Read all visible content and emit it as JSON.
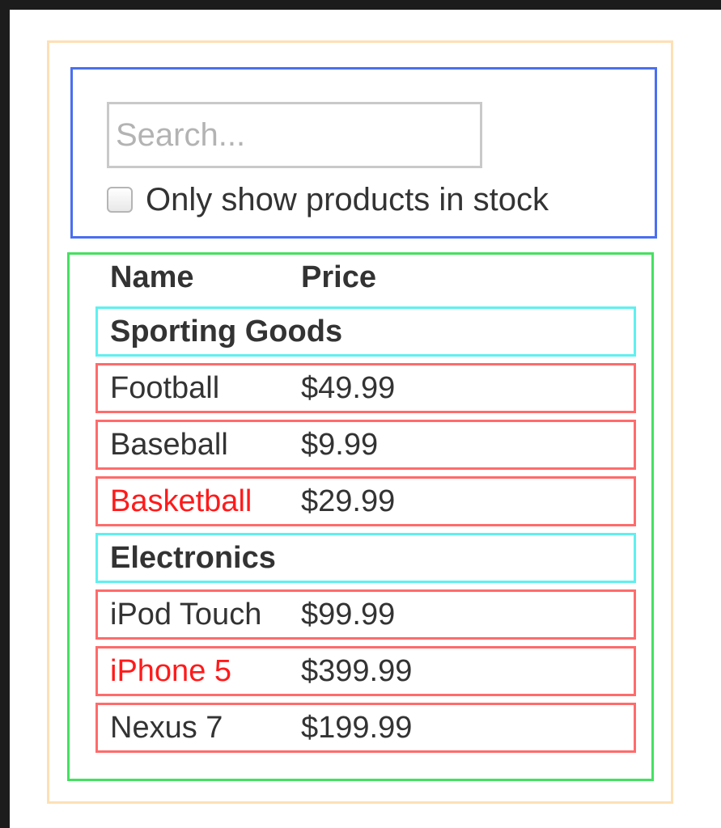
{
  "search_bar": {
    "placeholder": "Search...",
    "value": "",
    "stock_label": "Only show products in stock",
    "stock_checked": false
  },
  "table": {
    "headers": {
      "name": "Name",
      "price": "Price"
    },
    "categories": [
      {
        "name": "Sporting Goods",
        "products": [
          {
            "name": "Football",
            "price": "$49.99",
            "stocked": true
          },
          {
            "name": "Baseball",
            "price": "$9.99",
            "stocked": true
          },
          {
            "name": "Basketball",
            "price": "$29.99",
            "stocked": false
          }
        ]
      },
      {
        "name": "Electronics",
        "products": [
          {
            "name": "iPod Touch",
            "price": "$99.99",
            "stocked": true
          },
          {
            "name": "iPhone 5",
            "price": "$399.99",
            "stocked": false
          },
          {
            "name": "Nexus 7",
            "price": "$199.99",
            "stocked": true
          }
        ]
      }
    ]
  },
  "colors": {
    "outer_border": "#fde0b5",
    "search_border": "#4a6ff0",
    "table_border": "#45e060",
    "category_border": "#5ff0f0",
    "product_border": "#ff6b6b",
    "out_of_stock_text": "#ff1a1a"
  }
}
